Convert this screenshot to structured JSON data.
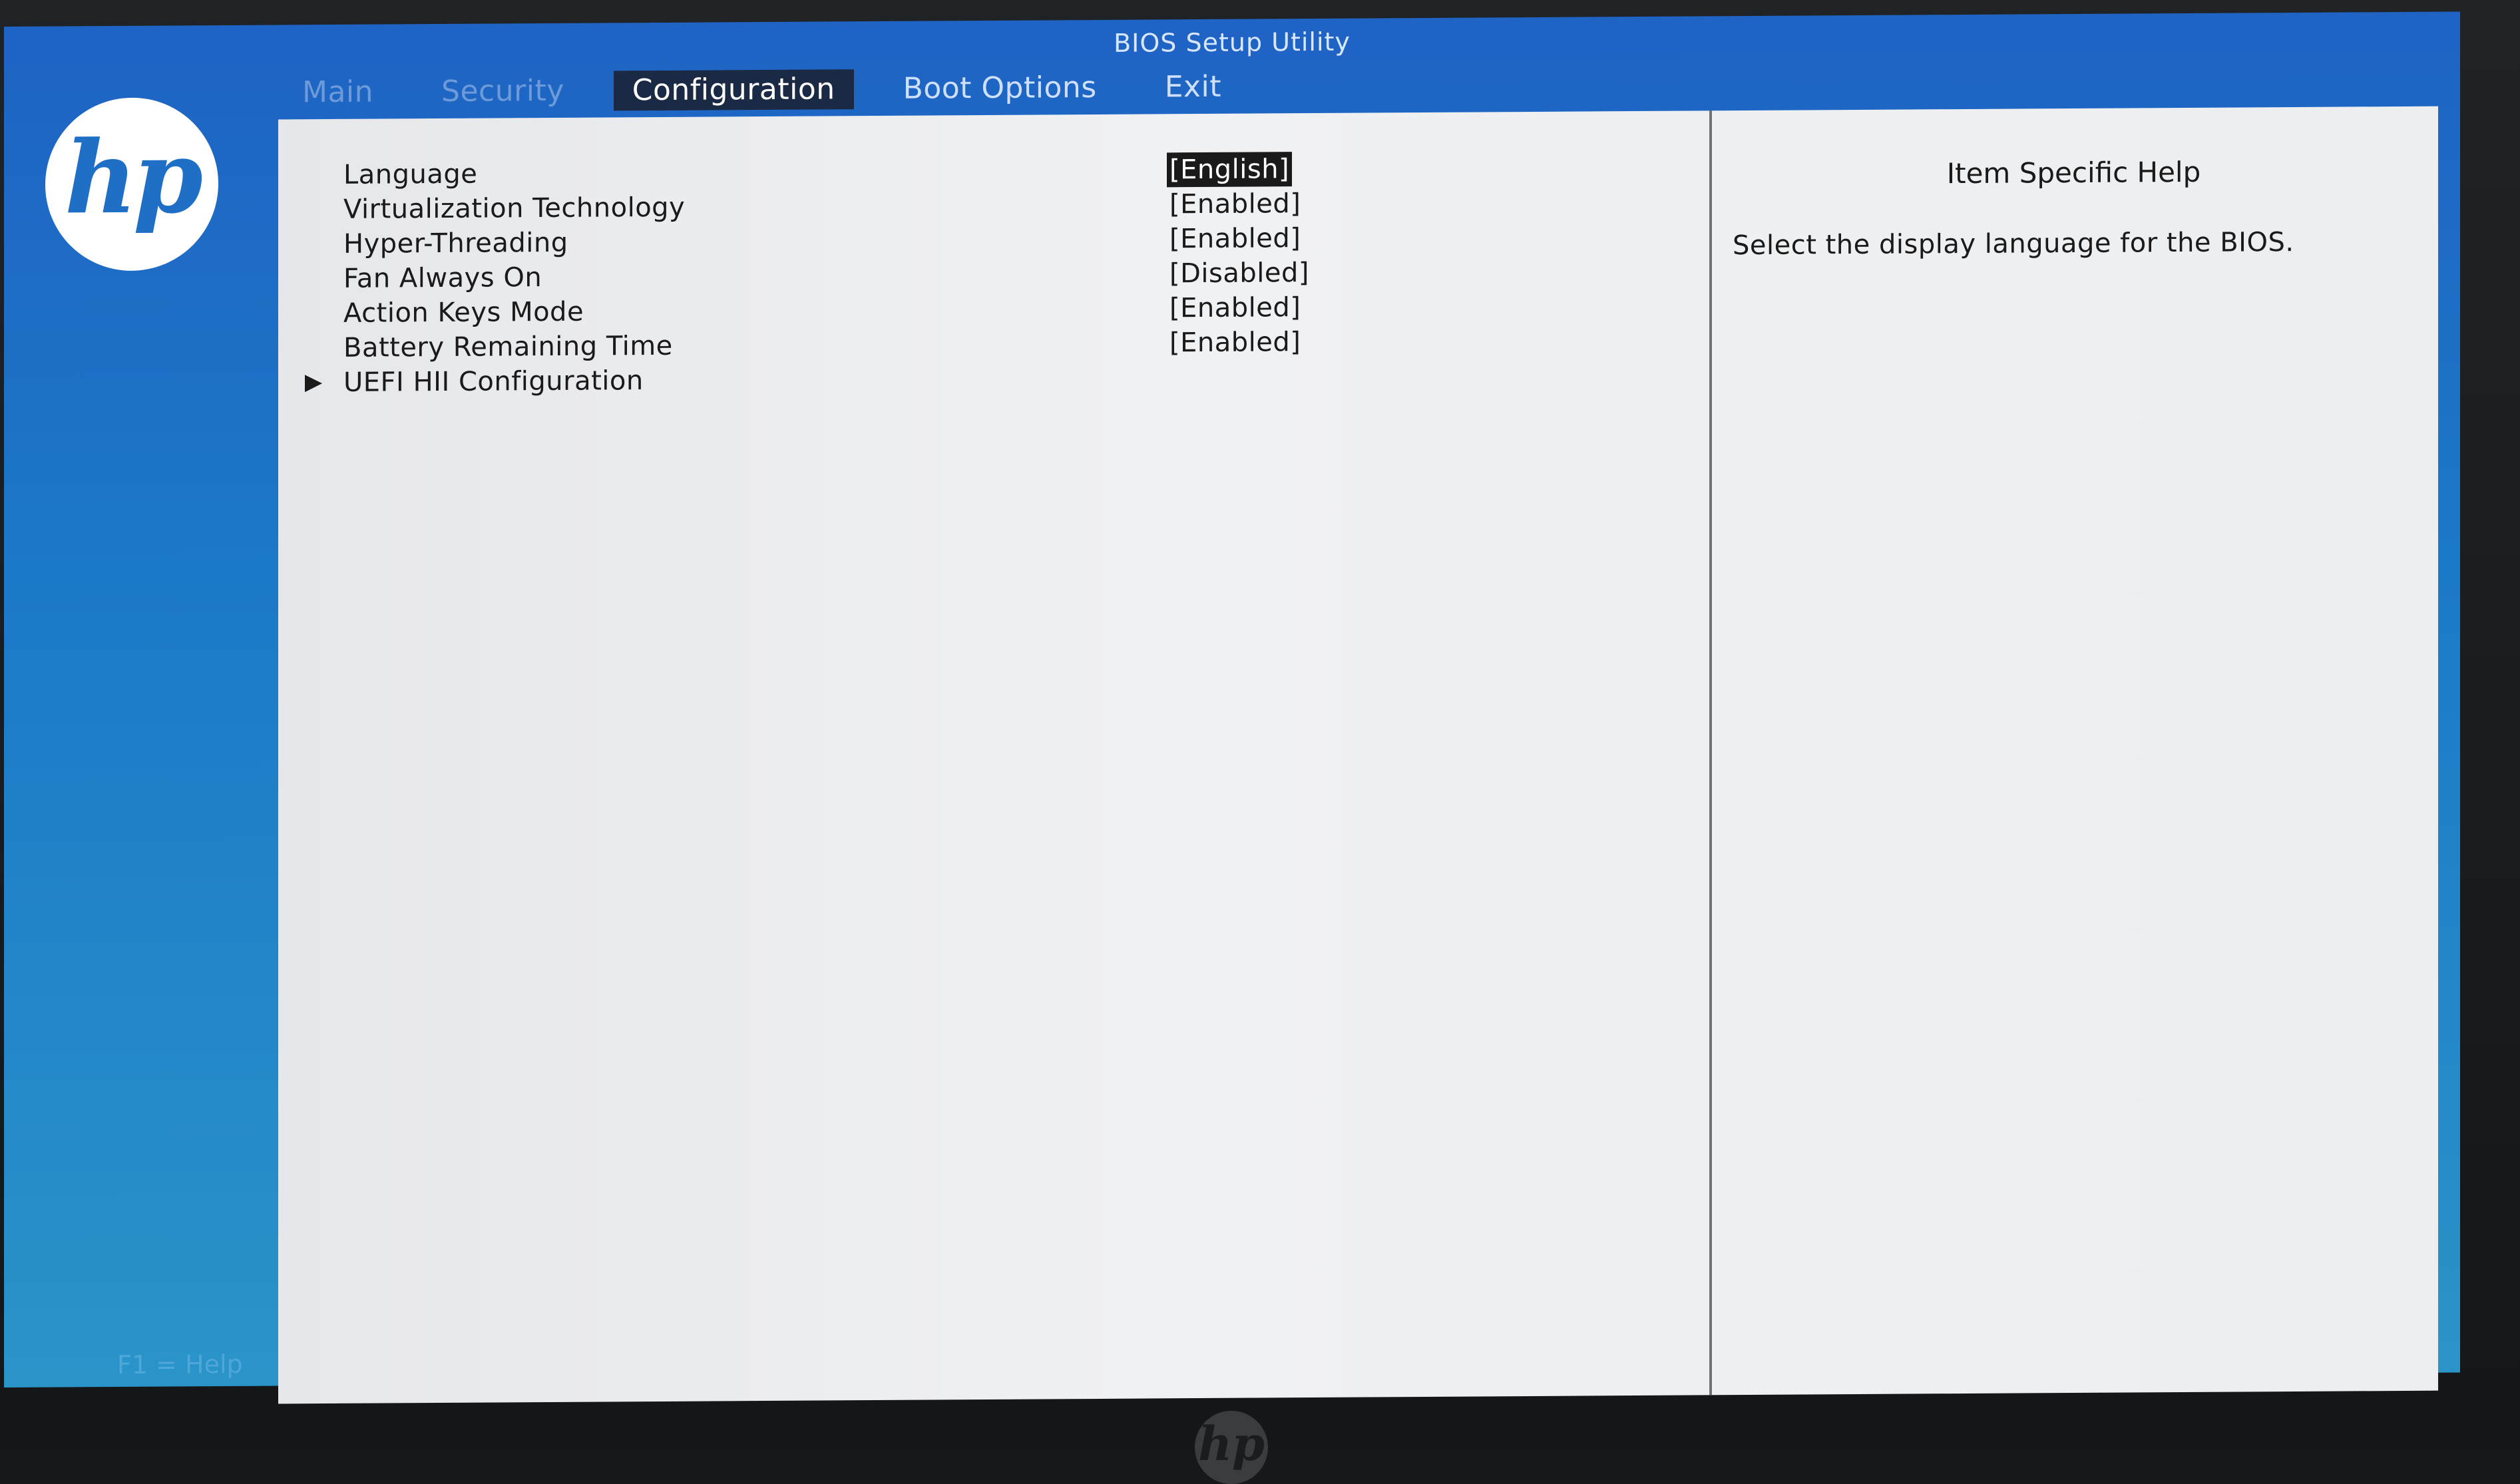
{
  "window": {
    "title": "BIOS Setup Utility"
  },
  "tabs": [
    {
      "label": "Main",
      "state": "dim"
    },
    {
      "label": "Security",
      "state": "dim"
    },
    {
      "label": "Configuration",
      "state": "active"
    },
    {
      "label": "Boot Options",
      "state": "normal"
    },
    {
      "label": "Exit",
      "state": "normal"
    }
  ],
  "logo": {
    "text": "hp"
  },
  "settings": [
    {
      "label": "Language",
      "value": "[English]",
      "selected": true
    },
    {
      "label": "Virtualization Technology",
      "value": "[Enabled]"
    },
    {
      "label": "Hyper-Threading",
      "value": "[Enabled]"
    },
    {
      "label": "Fan Always On",
      "value": "[Disabled]"
    },
    {
      "label": "Action Keys Mode",
      "value": "[Enabled]"
    },
    {
      "label": "Battery Remaining Time",
      "value": "[Enabled]"
    },
    {
      "label": "UEFI HII Configuration",
      "submenu": true
    }
  ],
  "help": {
    "title": "Item Specific Help",
    "text": "Select the display language for the BIOS."
  },
  "footer": {
    "hint": "F1 = Help"
  },
  "colors": {
    "screen_blue": "#1f63c4",
    "panel_bg": "#eceef0",
    "selected_bg": "#1a1a1a"
  }
}
